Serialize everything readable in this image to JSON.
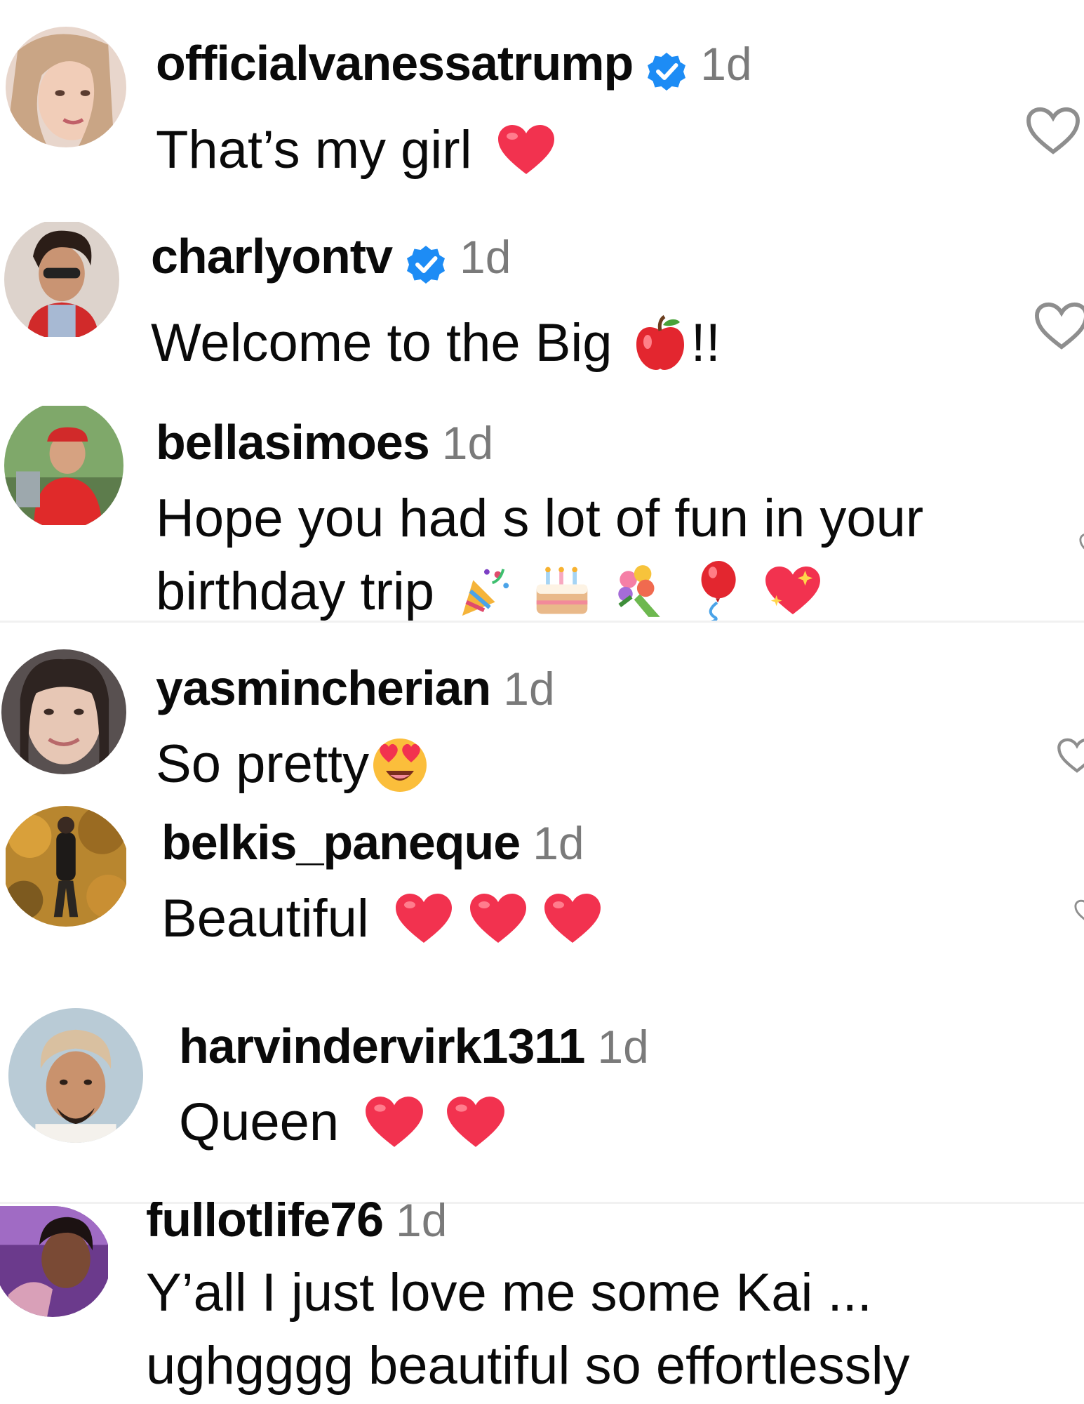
{
  "comments": [
    {
      "username": "officialvanessatrump",
      "verified": true,
      "time": "1d",
      "text": "That’s my girl",
      "emojis": [
        "red-heart"
      ]
    },
    {
      "username": "charlyontv",
      "verified": true,
      "time": "1d",
      "text": "Welcome to the Big",
      "emojis": [
        "red-apple"
      ],
      "suffix": "!!"
    },
    {
      "username": "bellasimoes",
      "verified": false,
      "time": "1d",
      "text_line1": "Hope you had s lot of fun in your",
      "text_line2": "birthday trip",
      "emojis": [
        "party-popper",
        "birthday-cake",
        "bouquet",
        "balloon",
        "sparkling-heart"
      ]
    },
    {
      "username": "yasmincherian",
      "verified": false,
      "time": "1d",
      "text": "So pretty",
      "emojis": [
        "star-struck-heart-eyes"
      ]
    },
    {
      "username": "belkis_paneque",
      "verified": false,
      "time": "1d",
      "text": "Beautiful",
      "emojis": [
        "red-heart",
        "red-heart",
        "red-heart"
      ]
    },
    {
      "username": "harvindervirk1311",
      "verified": false,
      "time": "1d",
      "text": "Queen",
      "emojis": [
        "red-heart",
        "red-heart"
      ]
    },
    {
      "username": "fullotlife76",
      "verified": false,
      "time": "1d",
      "text_line1": "Y’all I just love me some Kai ...",
      "text_line2": "ughgggg beautiful so effortlessly"
    }
  ],
  "colors": {
    "verified_badge": "#1d8cf5",
    "heart_emoji": "#f2324f",
    "time_text": "#7a7a7a",
    "like_outline": "#8e8e8e"
  }
}
